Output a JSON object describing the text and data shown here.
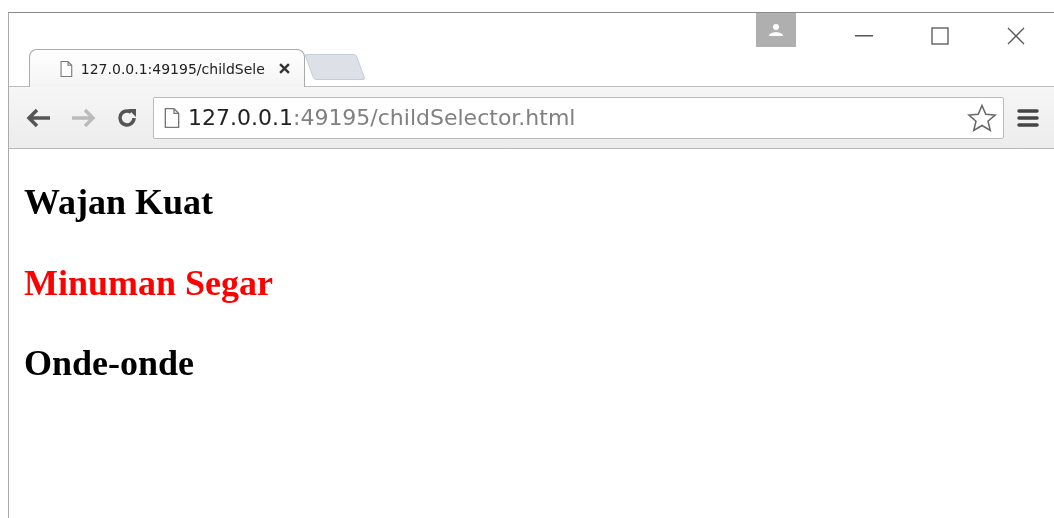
{
  "tabs": [
    {
      "title": "127.0.0.1:49195/childSele",
      "selected": true,
      "kind": "page"
    },
    {
      "kind": "new"
    }
  ],
  "toolbar": {
    "back_disabled": false,
    "forward_disabled": true,
    "address": {
      "host": "127.0.0.1",
      "path": ":49195/childSelector.html"
    },
    "bookmarked": false
  },
  "content": {
    "headings": [
      {
        "text": "Wajan Kuat",
        "color": "#000000"
      },
      {
        "text": "Minuman Segar",
        "color": "#ff0000"
      },
      {
        "text": "Onde-onde",
        "color": "#000000"
      }
    ]
  }
}
